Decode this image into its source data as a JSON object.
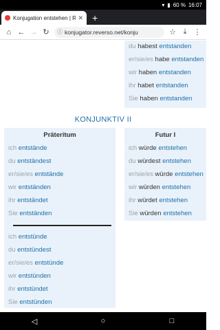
{
  "status": {
    "battery": "60 %",
    "time": "16:07"
  },
  "browser": {
    "tab_title": "Konjugation entstehen | R",
    "url": "konjugator.reverso.net/konju",
    "icons": [
      "home-icon",
      "back-icon",
      "forward-icon",
      "reload-icon",
      "info-icon",
      "star-icon",
      "download-icon",
      "more-icon"
    ]
  },
  "perfekt_tail": [
    {
      "pronoun": "du",
      "aux": "habest",
      "verb": "entstanden"
    },
    {
      "pronoun": "er/sie/es",
      "aux": "habe",
      "verb": "entstanden"
    },
    {
      "pronoun": "wir",
      "aux": "haben",
      "verb": "entstanden"
    },
    {
      "pronoun": "ihr",
      "aux": "habet",
      "verb": "entstanden"
    },
    {
      "pronoun": "Sie",
      "aux": "haben",
      "verb": "entstanden"
    }
  ],
  "section": {
    "title": "KONJUNKTIV II"
  },
  "praeteritum": {
    "heading": "Präteritum",
    "rows": [
      {
        "pronoun": "ich",
        "verb": "entstände"
      },
      {
        "pronoun": "du",
        "verb": "entständest"
      },
      {
        "pronoun": "er/sie/es",
        "verb": "entstände"
      },
      {
        "pronoun": "wir",
        "verb": "entständen"
      },
      {
        "pronoun": "ihr",
        "verb": "entständet"
      },
      {
        "pronoun": "Sie",
        "verb": "entständen"
      }
    ],
    "rows_alt": [
      {
        "pronoun": "ich",
        "verb": "entstünde"
      },
      {
        "pronoun": "du",
        "verb": "entstündest"
      },
      {
        "pronoun": "er/sie/es",
        "verb": "entstünde"
      },
      {
        "pronoun": "wir",
        "verb": "entstünden"
      },
      {
        "pronoun": "ihr",
        "verb": "entstündet"
      },
      {
        "pronoun": "Sie",
        "verb": "entstünden"
      }
    ]
  },
  "futur1": {
    "heading": "Futur I",
    "rows": [
      {
        "pronoun": "ich",
        "aux": "würde",
        "verb": "entstehen"
      },
      {
        "pronoun": "du",
        "aux": "würdest",
        "verb": "entstehen"
      },
      {
        "pronoun": "er/sie/es",
        "aux": "würde",
        "verb": "entstehen"
      },
      {
        "pronoun": "wir",
        "aux": "würden",
        "verb": "entstehen"
      },
      {
        "pronoun": "ihr",
        "aux": "würdet",
        "verb": "entstehen"
      },
      {
        "pronoun": "Sie",
        "aux": "würden",
        "verb": "entstehen"
      }
    ]
  }
}
